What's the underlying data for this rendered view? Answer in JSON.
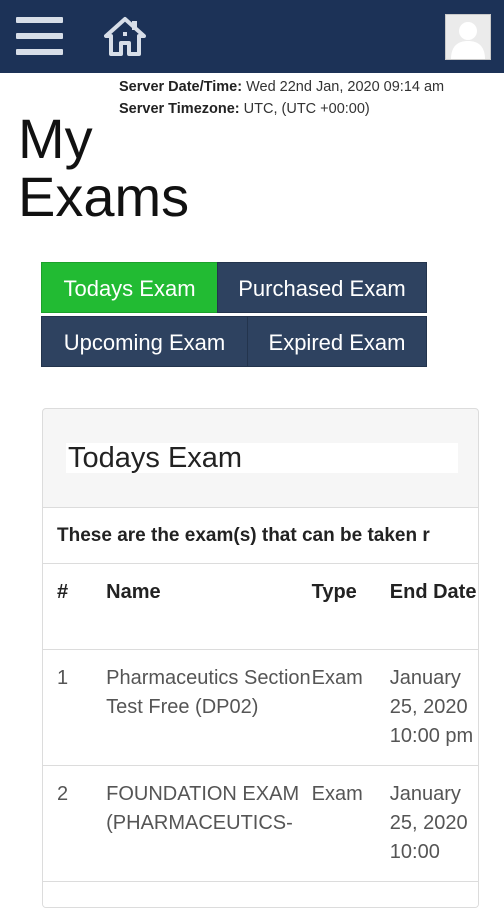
{
  "header": {
    "menu_icon": "hamburger-menu-icon",
    "home_icon": "home-icon",
    "avatar_icon": "user-avatar-icon",
    "bar_color": "#1c3257"
  },
  "server": {
    "datetime_label": "Server Date/Time:",
    "datetime_value": "Wed 22nd Jan, 2020 09:14 am",
    "timezone_label": "Server Timezone:",
    "timezone_value": "UTC, (UTC +00:00)"
  },
  "page": {
    "title": "My Exams"
  },
  "tabs": [
    {
      "label": "Todays Exam",
      "active": true
    },
    {
      "label": "Purchased Exam",
      "active": false
    },
    {
      "label": "Upcoming Exam",
      "active": false
    },
    {
      "label": "Expired Exam",
      "active": false
    }
  ],
  "colors": {
    "active_tab": "#22bb33",
    "inactive_tab": "#2e4260"
  },
  "card": {
    "title": "Todays Exam",
    "notice": "These are the exam(s) that can be taken r",
    "columns": [
      "#",
      "Name",
      "Type",
      "End Date"
    ],
    "rows": [
      {
        "num": "1",
        "name": "Pharmaceutics Section Test Free (DP02)",
        "type": "Exam",
        "end_date": "January 25, 2020 10:00 pm"
      },
      {
        "num": "2",
        "name": "FOUNDATION EXAM (PHARMACEUTICS-",
        "type": "Exam",
        "end_date": "January 25, 2020 10:00"
      }
    ]
  }
}
